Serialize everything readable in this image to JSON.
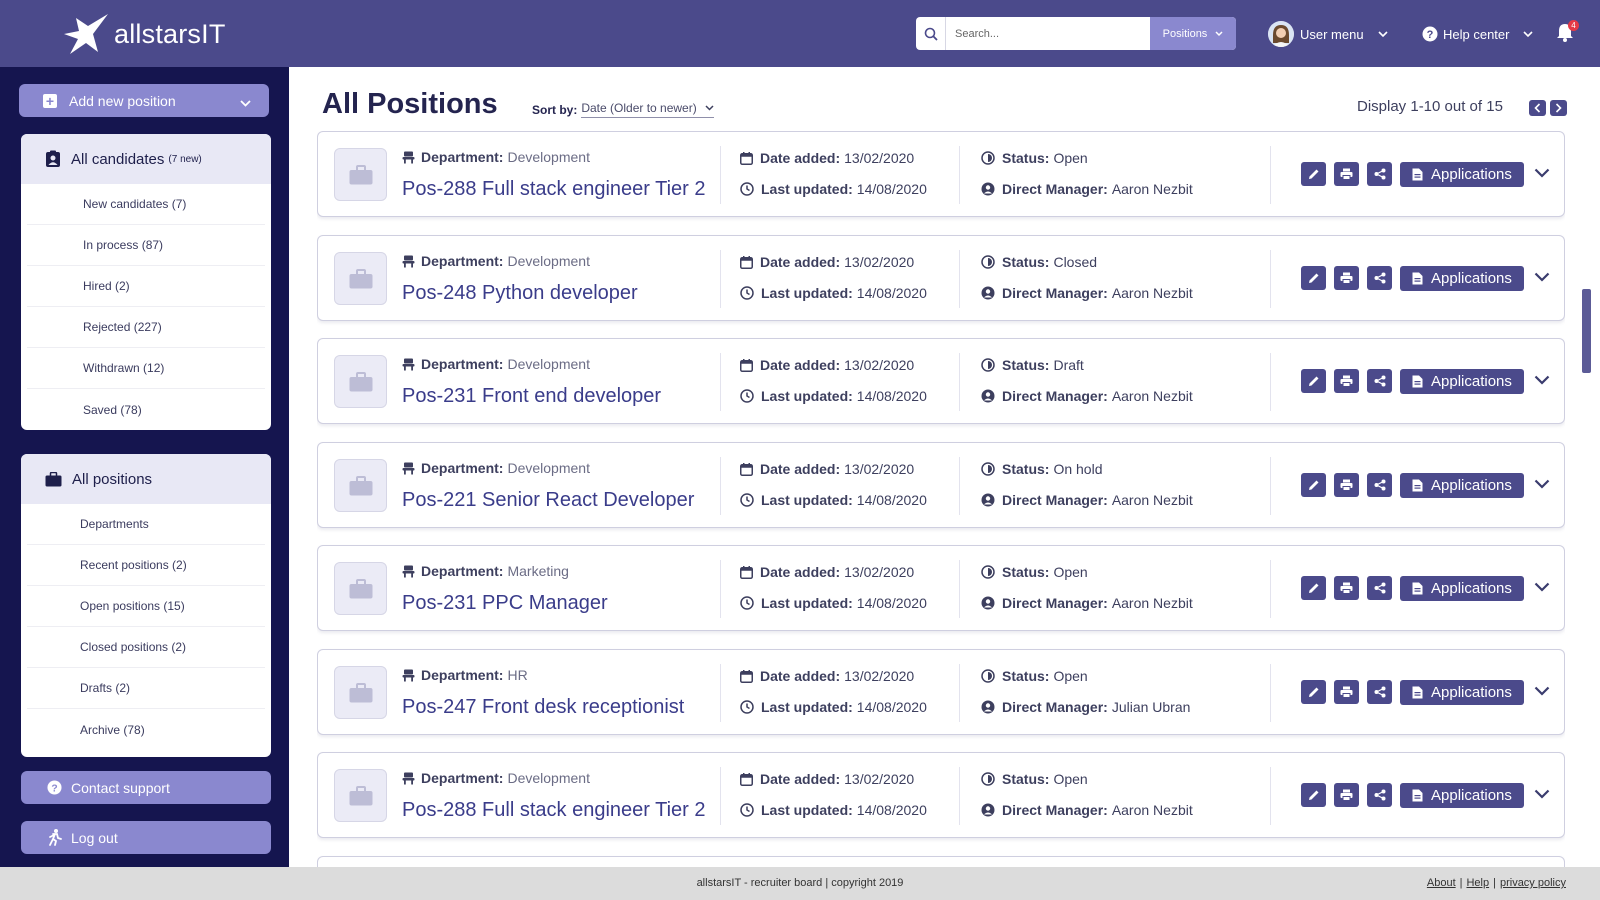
{
  "header": {
    "logo_text": "allstarsIT",
    "search_placeholder": "Search...",
    "search_scope": "Positions",
    "user_menu": "User menu",
    "help_center": "Help center",
    "notification_count": "4"
  },
  "sidebar": {
    "add_new_position": "Add new position",
    "candidates": {
      "title": "All candidates",
      "badge": "(7 new)",
      "items": [
        "New candidates (7)",
        "In process (87)",
        "Hired (2)",
        "Rejected (227)",
        "Withdrawn (12)",
        "Saved (78)"
      ]
    },
    "positions": {
      "title": "All positions",
      "items": [
        "Departments",
        "Recent positions (2)",
        "Open positions (15)",
        "Closed positions (2)",
        "Drafts (2)",
        "Archive (78)"
      ]
    },
    "contact_support": "Contact support",
    "log_out": "Log out"
  },
  "main": {
    "title": "All Positions",
    "sort_label": "Sort by:",
    "sort_value": "Date (Older to newer)",
    "display_text": "Display 1-10 out of 15",
    "labels": {
      "department": "Department:",
      "date_added": "Date added:",
      "last_updated": "Last updated:",
      "status": "Status:",
      "direct_manager": "Direct Manager:",
      "applications": "Applications"
    },
    "positions": [
      {
        "department": "Development",
        "title": "Pos-288 Full stack engineer Tier 2",
        "date_added": "13/02/2020",
        "last_updated": "14/08/2020",
        "status": "Open",
        "manager": "Aaron Nezbit"
      },
      {
        "department": "Development",
        "title": "Pos-248 Python developer",
        "date_added": "13/02/2020",
        "last_updated": "14/08/2020",
        "status": "Closed",
        "manager": "Aaron Nezbit"
      },
      {
        "department": "Development",
        "title": "Pos-231 Front end developer",
        "date_added": "13/02/2020",
        "last_updated": "14/08/2020",
        "status": "Draft",
        "manager": "Aaron Nezbit"
      },
      {
        "department": "Development",
        "title": "Pos-221 Senior React Developer",
        "date_added": "13/02/2020",
        "last_updated": "14/08/2020",
        "status": "On hold",
        "manager": "Aaron Nezbit"
      },
      {
        "department": "Marketing",
        "title": "Pos-231 PPC Manager",
        "date_added": "13/02/2020",
        "last_updated": "14/08/2020",
        "status": "Open",
        "manager": "Aaron Nezbit"
      },
      {
        "department": "HR",
        "title": "Pos-247 Front desk receptionist",
        "date_added": "13/02/2020",
        "last_updated": "14/08/2020",
        "status": "Open",
        "manager": "Julian Ubran"
      },
      {
        "department": "Development",
        "title": "Pos-288 Full stack engineer Tier 2",
        "date_added": "13/02/2020",
        "last_updated": "14/08/2020",
        "status": "Open",
        "manager": "Aaron Nezbit"
      }
    ]
  },
  "footer": {
    "copyright": "allstarsIT - recruiter board | copyright 2019",
    "about": "About",
    "help": "Help",
    "privacy": "privacy policy"
  },
  "colors": {
    "header_bg": "#4b4a8b",
    "sidebar_bg": "#15154f",
    "accent": "#8a88cf",
    "title_blue": "#3a3c8a"
  }
}
